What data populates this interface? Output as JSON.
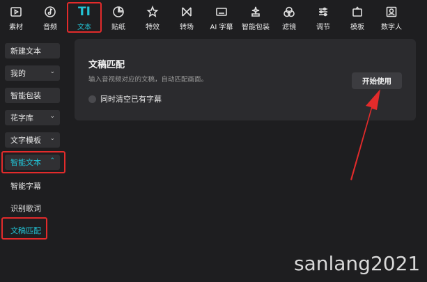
{
  "toolbar": {
    "items": [
      {
        "label": "素材",
        "icon": "media-icon"
      },
      {
        "label": "音频",
        "icon": "music-note-icon"
      },
      {
        "label": "文本",
        "icon": "text-TI-icon",
        "glyph": "TI"
      },
      {
        "label": "贴纸",
        "icon": "sticker-icon"
      },
      {
        "label": "特效",
        "icon": "sparkle-star-icon"
      },
      {
        "label": "转场",
        "icon": "transition-bowtie-icon"
      },
      {
        "label": "AI 字幕",
        "icon": "subtitle-icon"
      },
      {
        "label": "智能包装",
        "icon": "magic-sparkle-icon"
      },
      {
        "label": "滤镜",
        "icon": "filter-circles-icon"
      },
      {
        "label": "调节",
        "icon": "adjust-sliders-icon"
      },
      {
        "label": "模板",
        "icon": "template-icon"
      },
      {
        "label": "数字人",
        "icon": "digital-human-icon"
      }
    ],
    "active_index": 2
  },
  "sidebar": {
    "new_text": "新建文本",
    "mine": "我的",
    "smart_pack": "智能包装",
    "flower_text": "花字库",
    "text_template": "文字模板",
    "smart_text": "智能文本",
    "sub_items": [
      "智能字幕",
      "识别歌词",
      "文稿匹配"
    ]
  },
  "panel": {
    "title": "文稿匹配",
    "desc": "输入音视频对应的文稿，自动匹配画面。",
    "checkbox_label": "同时清空已有字幕",
    "start_button": "开始使用"
  },
  "watermark": "sanlang2021",
  "colors": {
    "accent": "#22c4d6",
    "highlight_red": "#e32b2b",
    "background": "#1e1e20",
    "panel": "#2b2b2e"
  }
}
